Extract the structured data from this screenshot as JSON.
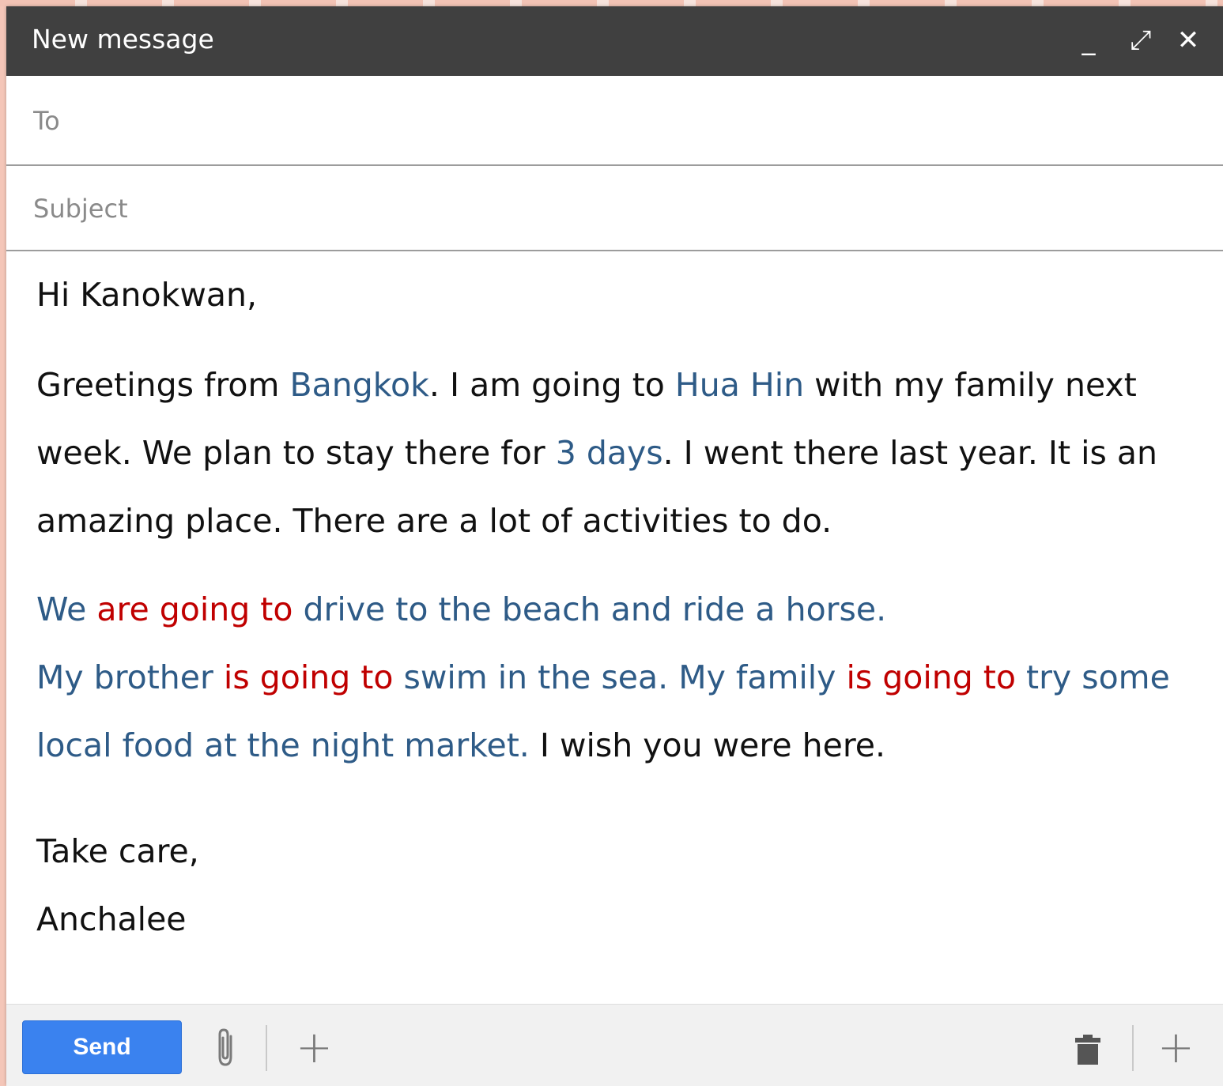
{
  "window": {
    "title": "New message",
    "minimize_icon": "minimize-icon",
    "expand_icon": "expand-icon",
    "close_icon": "close-icon",
    "minimize_label": "_",
    "expand_label": "⤢",
    "close_label": "✕"
  },
  "fields": {
    "to_placeholder": "To",
    "to_value": "",
    "subject_placeholder": "Subject",
    "subject_value": ""
  },
  "body": {
    "greeting": "Hi Kanokwan,",
    "p1": {
      "s1": "Greetings from ",
      "s2": "Bangkok",
      "s3": ". I am going to ",
      "s4": "Hua Hin",
      "s5": " with my family next week. We plan to stay there for ",
      "s6": "3 days",
      "s7": ". I went there last year. It is an amazing place. There are a lot of activities to do."
    },
    "p2": {
      "s1": "We ",
      "s2": "are going to",
      "s3": " drive to the beach and ride a horse.",
      "s4": "My brother ",
      "s5": "is going to",
      "s6": " swim in the sea. My family ",
      "s7": "is going to",
      "s8": " try some local food at the night market.",
      "s9": " I wish you were here."
    },
    "closing": "Take care,",
    "signature": "Anchalee"
  },
  "toolbar": {
    "send_label": "Send",
    "attach_icon": "paperclip-icon",
    "more_icon": "plus-icon",
    "trash_icon": "trash-icon",
    "more_right_icon": "plus-icon",
    "plus_glyph": "+"
  },
  "colors": {
    "titlebar": "#404040",
    "send_button": "#3a82ef",
    "highlight_blue": "#2e5b87",
    "highlight_red": "#c00000"
  }
}
